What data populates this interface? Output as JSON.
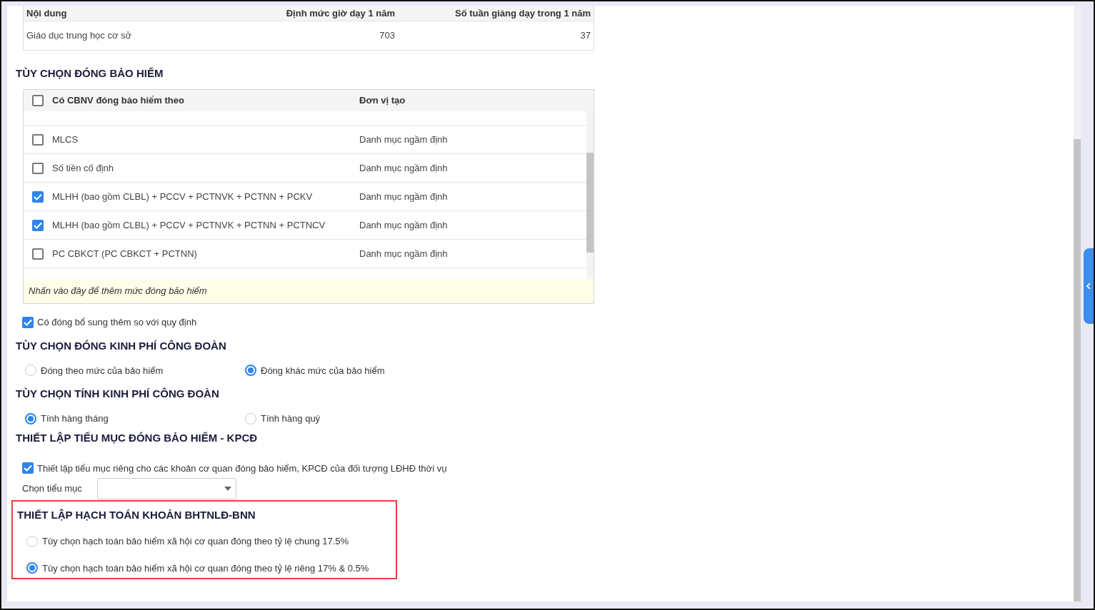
{
  "norm_table": {
    "columns": [
      "Nội dung",
      "Định mức giờ dạy 1 năm",
      "Số tuần giảng dạy trong 1 năm"
    ],
    "rows": [
      [
        "Giáo dục trung học cơ sở",
        "703",
        "37"
      ]
    ]
  },
  "insurance": {
    "title": "TÙY CHỌN ĐÓNG BẢO HIỂM",
    "header_checked": false,
    "columns": [
      "Có CBNV đóng bảo hiểm theo",
      "Đơn vị tạo"
    ],
    "rows": [
      {
        "name": "MLCS",
        "unit": "Danh mục ngầm định",
        "checked": false
      },
      {
        "name": "Số tiền cố định",
        "unit": "Danh mục ngầm định",
        "checked": false
      },
      {
        "name": "MLHH (bao gồm CLBL) + PCCV + PCTNVK + PCTNN + PCKV",
        "unit": "Danh mục ngầm định",
        "checked": true
      },
      {
        "name": "MLHH (bao gồm CLBL) + PCCV + PCTNVK + PCTNN + PCTNCV",
        "unit": "Danh mục ngầm định",
        "checked": true
      },
      {
        "name": "PC CBKCT (PC CBKCT + PCTNN)",
        "unit": "Danh mục ngầm định",
        "checked": false
      }
    ],
    "add_hint": "Nhấn vào đây để thêm mức đóng bảo hiểm"
  },
  "extra_option": {
    "label": "Có đóng bổ sung thêm so với quy định",
    "checked": true
  },
  "sections": [
    {
      "title": "TÙY CHỌN ĐÓNG KINH PHÍ CÔNG ĐOÀN",
      "options": [
        {
          "label": "Đóng theo mức của bảo hiểm",
          "selected": false
        },
        {
          "label": "Đóng khác mức của bảo hiểm",
          "selected": true
        }
      ]
    },
    {
      "title": "TÙY CHỌN TÍNH KINH PHÍ CÔNG ĐOÀN",
      "options": [
        {
          "label": "Tính hàng tháng",
          "selected": true
        },
        {
          "label": "Tính hàng quý",
          "selected": false
        }
      ]
    }
  ],
  "subitem": {
    "title": "THIẾT LẬP TIỂU MỤC ĐÓNG BẢO HIỂM - KPCĐ",
    "checkbox": {
      "label": "Thiết lập tiểu mục riêng cho các khoản cơ quan đóng bảo hiểm, KPCĐ của đối tượng LĐHĐ thời vụ",
      "checked": true
    },
    "select_label": "Chọn tiểu mục"
  },
  "accounting": {
    "title": "THIẾT LẬP HẠCH TOÁN KHOẢN BHTNLĐ-BNN",
    "highlighted": true,
    "options": [
      {
        "label": "Tùy chọn hạch toán bảo hiểm xã hội cơ quan đóng theo tỷ lệ chung 17.5%",
        "selected": false
      },
      {
        "label": "Tùy chọn hạch toán bảo hiểm xã hội cơ quan đóng theo tỷ lệ riêng 17% & 0.5%",
        "selected": true
      }
    ]
  }
}
